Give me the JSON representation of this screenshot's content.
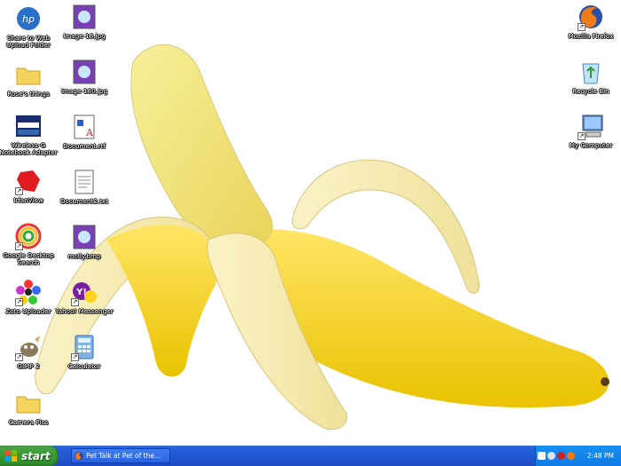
{
  "desktop": {
    "icons_left": [
      {
        "label": "Share to Web Upload Folder",
        "icon": "hp-share-icon"
      },
      {
        "label": "Rose's things",
        "icon": "folder-icon"
      },
      {
        "label": "Wireless-G Notebook Adapter",
        "icon": "linksys-icon"
      },
      {
        "label": "IrfanView",
        "icon": "irfanview-icon"
      },
      {
        "label": "Google Desktop Search",
        "icon": "google-desktop-icon"
      },
      {
        "label": "Zoto Uploader",
        "icon": "zoto-flower-icon"
      },
      {
        "label": "GIMP 2",
        "icon": "gimp-icon"
      },
      {
        "label": "Camera Pics",
        "icon": "folder-icon"
      }
    ],
    "icons_mid": [
      {
        "label": "image-18.jpg",
        "icon": "image-file-icon"
      },
      {
        "label": "image-180.jpg",
        "icon": "image-file-icon"
      },
      {
        "label": "Document.rtf",
        "icon": "rtf-document-icon"
      },
      {
        "label": "Document2.txt",
        "icon": "text-document-icon"
      },
      {
        "label": "molly.bmp",
        "icon": "image-file-icon"
      },
      {
        "label": "Yahoo! Messenger",
        "icon": "yahoo-messenger-icon"
      },
      {
        "label": "Calculator",
        "icon": "calculator-icon"
      }
    ],
    "icons_right": [
      {
        "label": "Mozilla Firefox",
        "icon": "firefox-icon"
      },
      {
        "label": "Recycle Bin",
        "icon": "recycle-bin-icon"
      },
      {
        "label": "My Computer",
        "icon": "my-computer-icon"
      }
    ]
  },
  "taskbar": {
    "start_label": "start",
    "task_label": "Pet Talk at Pet of the...",
    "clock": "2:48 PM"
  }
}
